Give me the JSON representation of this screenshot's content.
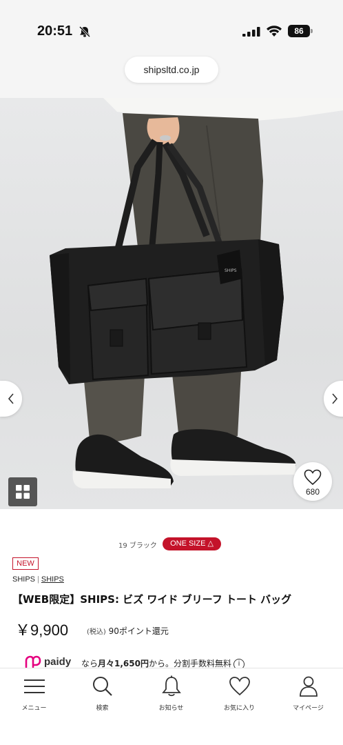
{
  "status_bar": {
    "time": "20:51",
    "battery": "86",
    "icons": [
      "bell-slash-icon",
      "signal-icon",
      "wifi-icon",
      "battery-icon"
    ]
  },
  "browser": {
    "url": "shipsltd.co.jp"
  },
  "gallery": {
    "prev_icon": "chevron-left-icon",
    "next_icon": "chevron-right-icon",
    "grid_icon": "grid-icon",
    "favorite_icon": "heart-icon",
    "favorite_count": "680"
  },
  "product": {
    "color": "19 ブラック",
    "size": "ONE SIZE △",
    "new_badge": "NEW",
    "brand_primary": "SHIPS",
    "brand_separator": "|",
    "brand_link": "SHIPS",
    "title": "【WEB限定】SHIPS: ビズ ワイド ブリーフ トート バッグ",
    "price": "￥9,900",
    "tax_note": "(税込)",
    "points": "90ポイント還元",
    "colors": {
      "accent": "#c4132a",
      "paidy": "#e5007f"
    }
  },
  "paidy": {
    "logo_text": "paidy",
    "prefix": "なら",
    "amount": "月々1,650円",
    "suffix": "から。分割手数料無料",
    "info_icon": "i"
  },
  "bottom_nav": {
    "items": [
      {
        "label": "メニュー",
        "icon": "menu-icon"
      },
      {
        "label": "検索",
        "icon": "search-icon"
      },
      {
        "label": "お知らせ",
        "icon": "bell-icon"
      },
      {
        "label": "お気に入り",
        "icon": "heart-icon"
      },
      {
        "label": "マイページ",
        "icon": "user-icon"
      }
    ]
  }
}
